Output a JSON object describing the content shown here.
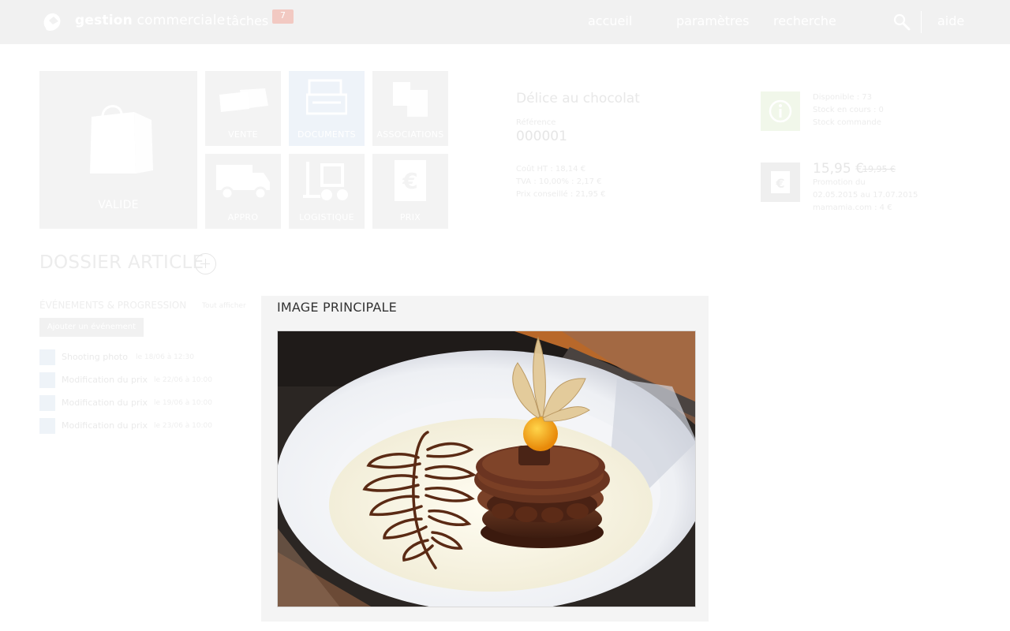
{
  "app": {
    "title_bold": "gestion",
    "title_rest": " commerciale"
  },
  "nav": {
    "tasks_label": "tâches",
    "tasks_count": "7",
    "home_label": "accueil",
    "settings_label": "paramètres",
    "search_label": "recherche",
    "help_label": "aide"
  },
  "tiles": {
    "valid_label": "VALIDE",
    "sale_label": "VENTE",
    "documents_label": "DOCUMENTS",
    "associations_label": "ASSOCIATIONS",
    "supply_label": "APPRO",
    "logistics_label": "LOGISTIQUE",
    "price_label": "PRIX"
  },
  "product": {
    "name": "Délice au chocolat",
    "ref_label": "Référence",
    "ref_value": "000001",
    "cost_line": "Coût HT : 18,14 €",
    "tax_line": "TVA : 10,00% : 2,17 €",
    "total_line": "Prix conseillé : 21,95 €"
  },
  "stock": {
    "line1": "Disponible : 73",
    "line2": "Stock en cours : 0",
    "line3": "Stock commande"
  },
  "pricing": {
    "price": "15,95 €",
    "old_price": "19,95 €",
    "line1": "Promotion du",
    "line2": "02.05.2015 au 17.07.2015",
    "line3": "mamamia.com : 4 €"
  },
  "dossier": {
    "title": "DOSSIER ARTICLE"
  },
  "events": {
    "title": "ÉVÉNEMENTS & PROGRESSION",
    "filter": "Tout afficher",
    "add_button": "Ajouter un événement",
    "items": [
      {
        "title": "Shooting photo",
        "date": "le 18/06 à 12:30"
      },
      {
        "title": "Modification du prix",
        "date": "le 22/06 à 10:00"
      },
      {
        "title": "Modification du prix",
        "date": "le 19/06 à 10:00"
      },
      {
        "title": "Modification du prix",
        "date": "le 23/06 à 10:00"
      }
    ]
  },
  "image_panel": {
    "title": "IMAGE PRINCIPALE"
  },
  "colors": {
    "topbar": "#f1f1f1",
    "tile": "#f3f3f3",
    "panel": "#f4f4f4"
  }
}
